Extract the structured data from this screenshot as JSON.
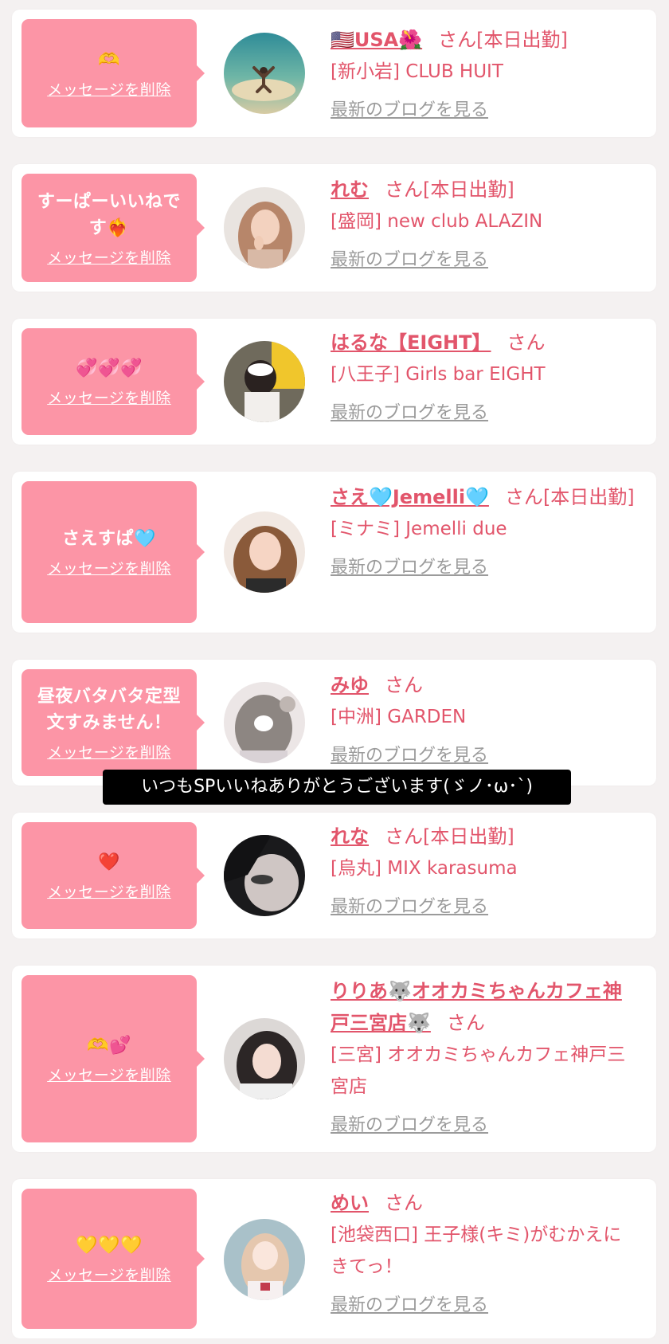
{
  "common": {
    "delete_label": "メッセージを削除",
    "blog_label": "最新のブログを見る",
    "san_label": "さん"
  },
  "subtitle": "いつもSPいいねありがとうございます(ゞノ･ω･`)",
  "items": [
    {
      "message": "🫶",
      "name": "🇺🇸USA🌺",
      "status": "[本日出勤]",
      "shop": "[新小岩] CLUB HUIT"
    },
    {
      "message": "すーぱーいいねです❤️‍🔥",
      "name": "れむ",
      "status": "[本日出勤]",
      "shop": "[盛岡] new club ALAZIN"
    },
    {
      "message": "💞💞💞",
      "name": "はるな【EIGHT】",
      "status": "",
      "shop": "[八王子] Girls bar EIGHT"
    },
    {
      "message": "さえすぱ🩵",
      "name": "さえ🩵Jemelli🩵",
      "status": "[本日出勤]",
      "shop": "[ミナミ] Jemelli due"
    },
    {
      "message": "昼夜バタバタ定型文すみません！",
      "name": "みゆ",
      "status": "",
      "shop": "[中洲] GARDEN"
    },
    {
      "message": "❤️",
      "name": "れな",
      "status": "[本日出勤]",
      "shop": "[烏丸] MIX karasuma"
    },
    {
      "message": "🫶💕",
      "name": "りりあ🐺オオカミちゃんカフェ神戸三宮店🐺",
      "status": "",
      "shop": "[三宮] オオカミちゃんカフェ神戸三宮店"
    },
    {
      "message": "💛💛💛",
      "name": "めい",
      "status": "",
      "shop": "[池袋西口] 王子様(キミ)がむかえにきてっ！"
    }
  ],
  "colors": {
    "bubble": "#fc95a6",
    "accent": "#e2556b",
    "link_gray": "#9b9b9b",
    "page_bg": "#f4f1f1"
  }
}
